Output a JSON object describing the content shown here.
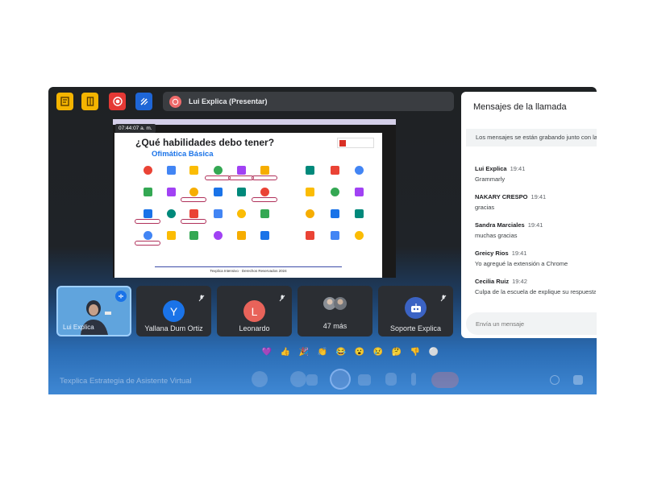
{
  "toolbar": {
    "icons": [
      "clipboard-icon",
      "document-icon",
      "record-icon",
      "edit-icon"
    ]
  },
  "presenter": {
    "name": "Lui Explica (Presentar)"
  },
  "screen": {
    "timestamp": "07:44:07 a. m.",
    "slide": {
      "title": "¿Qué habilidades debo tener?",
      "subtitle": "Ofimática Básica",
      "footer": "Texplica Intensivo · Derechos Reservados 2024"
    }
  },
  "participants": [
    {
      "name": "Lui Explica",
      "initial": "",
      "color": "#60a4dd"
    },
    {
      "name": "Yallana Dum Ortiz",
      "initial": "Y",
      "color": "#1a73e8"
    },
    {
      "name": "Leonardo",
      "initial": "L",
      "color": "#e8635a"
    },
    {
      "name": "47 más",
      "initial": "",
      "color": "#5f6368"
    },
    {
      "name": "Soporte Explica",
      "initial": "",
      "color": "#3b63c4"
    }
  ],
  "chat": {
    "title": "Mensajes de la llamada",
    "notice": "Los mensajes se están grabando junto con la",
    "messages": [
      {
        "author": "Lui Explica",
        "time": "19:41",
        "text": "Grammarly"
      },
      {
        "author": "NAKARY CRESPO",
        "time": "19:41",
        "text": "gracias"
      },
      {
        "author": "Sandra Marciales",
        "time": "19:41",
        "text": "muchas gracias"
      },
      {
        "author": "Greicy Rios",
        "time": "19:41",
        "text": "Yo agregué la extensión a Chrome"
      },
      {
        "author": "Cecilia Ruiz",
        "time": "19:42",
        "text": "Culpa de la escuela de explique su respuesta"
      }
    ],
    "input_placeholder": "Envía un mensaje"
  },
  "reactions": [
    "💜",
    "👍",
    "🎉",
    "👏",
    "😂",
    "😮",
    "😢",
    "🤔",
    "👎",
    "⚪"
  ],
  "meeting": {
    "name": "Texplica Estrategia de Asistente Virtual"
  },
  "accent": "#1a73e8"
}
